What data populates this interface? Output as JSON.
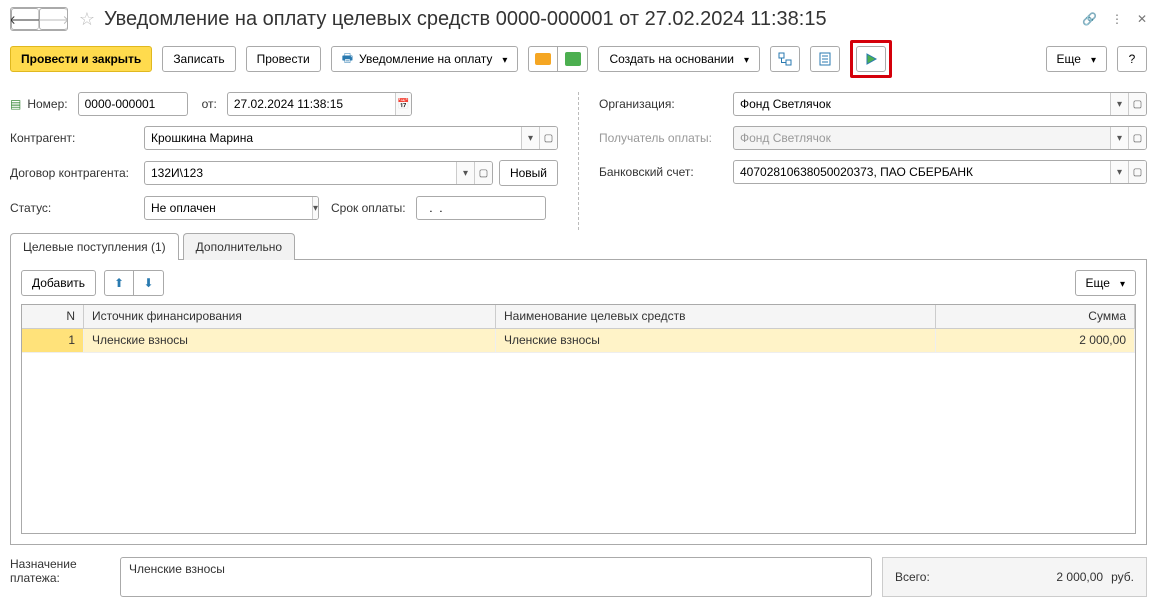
{
  "header": {
    "title": "Уведомление на оплату целевых средств 0000-000001 от 27.02.2024 11:38:15"
  },
  "toolbar": {
    "post_close": "Провести и закрыть",
    "save": "Записать",
    "post": "Провести",
    "notice": "Уведомление на оплату",
    "create_based": "Создать на основании",
    "more": "Еще",
    "help": "?"
  },
  "left": {
    "number_label": "Номер:",
    "number": "0000-000001",
    "from_label": "от:",
    "date": "27.02.2024 11:38:15",
    "counterparty_label": "Контрагент:",
    "counterparty": "Крошкина Марина",
    "contract_label": "Договор контрагента:",
    "contract": "132И\\123",
    "new_btn": "Новый",
    "status_label": "Статус:",
    "status": "Не оплачен",
    "due_label": "Срок оплаты:",
    "due_value": "  .  .    "
  },
  "right": {
    "org_label": "Организация:",
    "org": "Фонд Светлячок",
    "payee_label": "Получатель оплаты:",
    "payee": "Фонд Светлячок",
    "bank_label": "Банковский счет:",
    "bank": "40702810638050020373, ПАО СБЕРБАНК"
  },
  "tabs": {
    "t1": "Целевые поступления (1)",
    "t2": "Дополнительно",
    "add": "Добавить",
    "more": "Еще",
    "cols": {
      "n": "N",
      "src": "Источник финансирования",
      "name": "Наименование целевых средств",
      "sum": "Сумма"
    },
    "rows": [
      {
        "n": "1",
        "src": "Членские взносы",
        "name": "Членские взносы",
        "sum": "2 000,00"
      }
    ]
  },
  "bottom": {
    "purpose_label": "Назначение платежа:",
    "purpose": "Членские взносы",
    "total_label": "Всего:",
    "total": "2 000,00",
    "currency": "руб."
  }
}
